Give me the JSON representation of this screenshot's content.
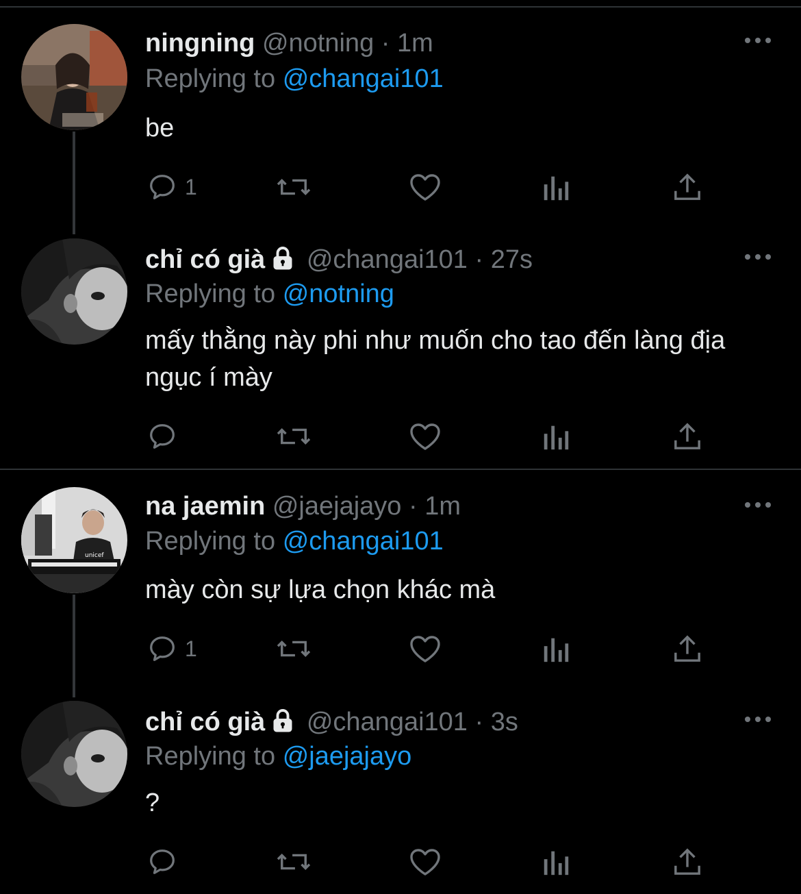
{
  "colors": {
    "background": "#000000",
    "text": "#e7e9ea",
    "muted": "#71767b",
    "link": "#1d9bf0",
    "divider": "#2f3336"
  },
  "tweets": [
    {
      "name": "ningning",
      "handle": "@notning",
      "time": "1m",
      "replying_label": "Replying to",
      "replying_to": "@changai101",
      "text": "be",
      "reply_count": "1",
      "locked": false,
      "avatar_icon": "user-photo-icon"
    },
    {
      "name": "chỉ có già",
      "handle": "@changai101",
      "time": "27s",
      "replying_label": "Replying to",
      "replying_to": "@notning",
      "text": "mấy thằng này phi như muốn cho tao đến làng địa ngục í mày",
      "reply_count": "",
      "locked": true,
      "avatar_icon": "user-photo-icon"
    },
    {
      "name": "na jaemin",
      "handle": "@jaejajayo",
      "time": "1m",
      "replying_label": "Replying to",
      "replying_to": "@changai101",
      "text": "mày còn sự lựa chọn khác mà",
      "reply_count": "1",
      "locked": false,
      "avatar_icon": "user-photo-icon"
    },
    {
      "name": "chỉ có già",
      "handle": "@changai101",
      "time": "3s",
      "replying_label": "Replying to",
      "replying_to": "@jaejajayo",
      "text": "?",
      "reply_count": "",
      "locked": true,
      "avatar_icon": "user-photo-icon"
    }
  ],
  "separator": "·"
}
